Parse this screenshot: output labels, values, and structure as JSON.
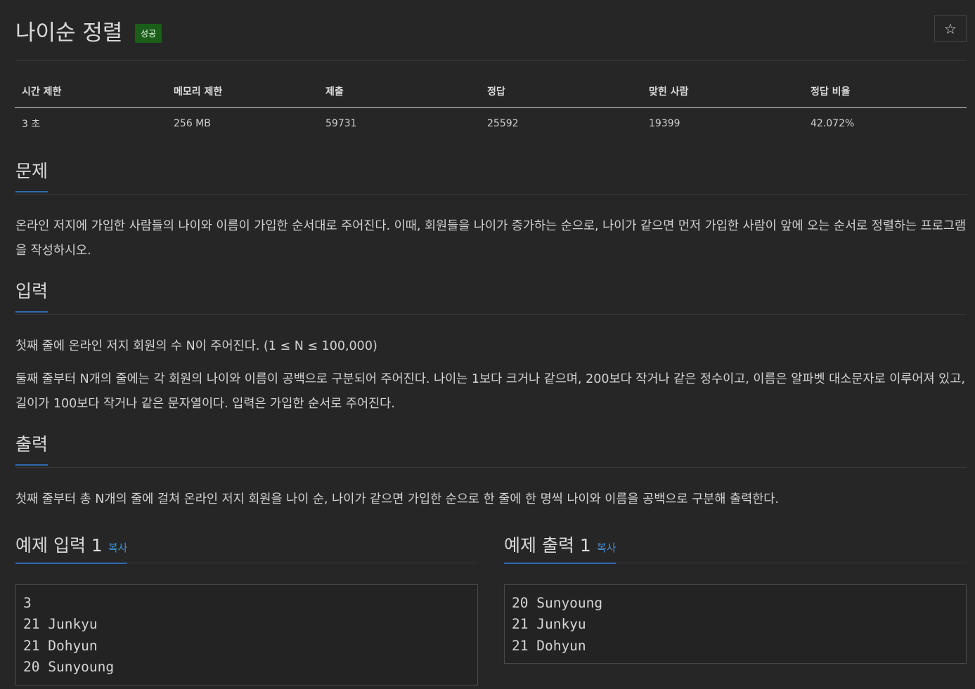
{
  "problem": {
    "title": "나이순 정렬",
    "status_badge": "성공",
    "star_label": "☆"
  },
  "stats": {
    "headers": [
      "시간 제한",
      "메모리 제한",
      "제출",
      "정답",
      "맞힌 사람",
      "정답 비율"
    ],
    "values": [
      "3 초",
      "256 MB",
      "59731",
      "25592",
      "19399",
      "42.072%"
    ]
  },
  "sections": {
    "problem": {
      "title": "문제",
      "text": "온라인 저지에 가입한 사람들의 나이와 이름이 가입한 순서대로 주어진다. 이때, 회원들을 나이가 증가하는 순으로, 나이가 같으면 먼저 가입한 사람이 앞에 오는 순서로 정렬하는 프로그램을 작성하시오."
    },
    "input": {
      "title": "입력",
      "line1": "첫째 줄에 온라인 저지 회원의 수 N이 주어진다. (1 ≤ N ≤ 100,000)",
      "line2": "둘째 줄부터 N개의 줄에는 각 회원의 나이와 이름이 공백으로 구분되어 주어진다. 나이는 1보다 크거나 같으며, 200보다 작거나 같은 정수이고, 이름은 알파벳 대소문자로 이루어져 있고, 길이가 100보다 작거나 같은 문자열이다. 입력은 가입한 순서로 주어진다."
    },
    "output": {
      "title": "출력",
      "text": "첫째 줄부터 총 N개의 줄에 걸쳐 온라인 저지 회원을 나이 순, 나이가 같으면 가입한 순으로 한 줄에 한 명씩 나이와 이름을 공백으로 구분해 출력한다."
    }
  },
  "samples": {
    "input": {
      "title": "예제 입력 1",
      "copy_label": "복사",
      "content": "3\n21 Junkyu\n21 Dohyun\n20 Sunyoung"
    },
    "output": {
      "title": "예제 출력 1",
      "copy_label": "복사",
      "content": "20 Sunyoung\n21 Junkyu\n21 Dohyun"
    }
  }
}
